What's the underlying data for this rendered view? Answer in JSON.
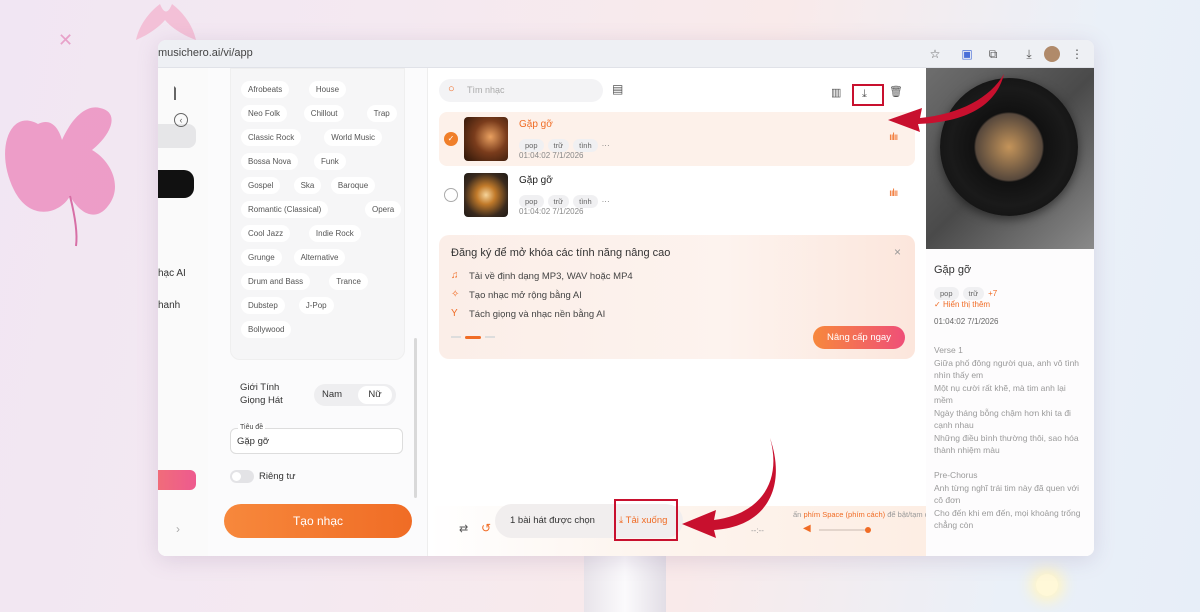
{
  "browser": {
    "url": "musichero.ai/vi/app"
  },
  "leftnav": {
    "item1": "hạc AI",
    "item2": "hanh"
  },
  "form": {
    "genres": [
      [
        "Afrobeats",
        "House"
      ],
      [
        "Neo Folk",
        "Chillout",
        "Trap"
      ],
      [
        "Classic Rock",
        "World Music"
      ],
      [
        "Bossa Nova",
        "Funk"
      ],
      [
        "Gospel",
        "Ska",
        "Baroque"
      ],
      [
        "Romantic (Classical)",
        "Opera"
      ],
      [
        "Cool Jazz",
        "Indie Rock"
      ],
      [
        "Grunge",
        "Alternative"
      ],
      [
        "Drum and Bass",
        "Trance"
      ],
      [
        "Dubstep",
        "J-Pop"
      ],
      [
        "Bollywood"
      ]
    ],
    "gender_label_1": "Giới Tính",
    "gender_label_2": "Giọng Hát",
    "gender_male": "Nam",
    "gender_female": "Nữ",
    "title_label": "Tiêu đề",
    "title_value": "Gặp gỡ",
    "private_label": "Riêng tư",
    "create_button": "Tạo nhạc"
  },
  "main": {
    "search_placeholder": "Tìm nhạc",
    "songs": [
      {
        "title": "Gặp gỡ",
        "tags": [
          "pop",
          "trữ",
          "tình"
        ],
        "more": "···",
        "meta": "01:04:02 7/1/2026",
        "selected": true
      },
      {
        "title": "Gặp gỡ",
        "tags": [
          "pop",
          "trữ",
          "tình"
        ],
        "more": "···",
        "meta": "01:04:02 7/1/2026",
        "selected": false
      }
    ],
    "promo": {
      "title": "Đăng ký để mở khóa các tính năng nâng cao",
      "features": [
        "Tải về định dạng MP3, WAV hoặc MP4",
        "Tạo nhạc mở rộng bằng AI",
        "Tách giọng và nhạc nền bằng AI"
      ],
      "close": "×",
      "upgrade_button": "Nâng cấp ngay"
    },
    "player": {
      "selected_count": "1 bài hát được chọn",
      "download_button": "Tải xuống",
      "hint_prefix": "ấn",
      "hint_key": "phím Space (phím cách)",
      "hint_suffix": "để bật/tạm dừng",
      "time": "--:--"
    }
  },
  "right": {
    "title": "Gặp gỡ",
    "tags": [
      "pop",
      "trữ"
    ],
    "more_tags": "+7",
    "show_more": "Hiển thị thêm",
    "meta": "01:04:02 7/1/2026",
    "lyrics": [
      "Verse 1",
      "Giữa phố đông người qua, anh vô tình nhìn thấy em",
      "Một nụ cười rất khẽ, mà tim anh lại mềm",
      "Ngày tháng bỗng chậm hơn khi ta đi cạnh nhau",
      "Những điều bình thường thôi, sao hóa thành nhiệm màu",
      "",
      "Pre-Chorus",
      "Anh từng nghĩ trái tim này đã quen với cô đơn",
      "Cho đến khi em đến, mọi khoảng trống chẳng còn"
    ]
  },
  "colors": {
    "accent": "#f06c25",
    "annotation_red": "#c8102e"
  }
}
